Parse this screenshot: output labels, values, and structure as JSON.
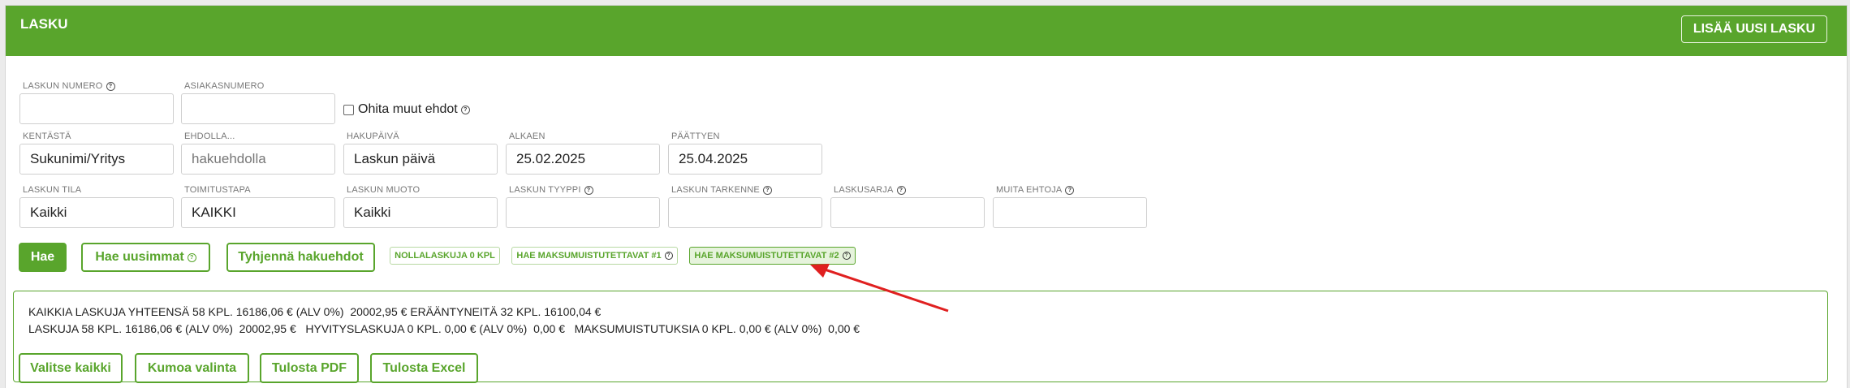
{
  "header": {
    "title": "LASKU",
    "add_button": "LISÄÄ UUSI LASKU"
  },
  "filters": {
    "laskun_numero": {
      "label": "LASKUN NUMERO",
      "value": ""
    },
    "asiakasnumero": {
      "label": "ASIAKASNUMERO",
      "value": ""
    },
    "ohita": {
      "label": "Ohita muut ehdot",
      "checked": false
    },
    "kentasta": {
      "label": "KENTÄSTÄ",
      "value": "Sukunimi/Yritys"
    },
    "ehdolla": {
      "label": "EHDOLLA...",
      "placeholder": "hakuehdolla"
    },
    "hakupaiva": {
      "label": "HAKUPÄIVÄ",
      "value": "Laskun päivä"
    },
    "alkaen": {
      "label": "ALKAEN",
      "value": "25.02.2025"
    },
    "paattyen": {
      "label": "PÄÄTTYEN",
      "value": "25.04.2025"
    },
    "laskun_tila": {
      "label": "LASKUN TILA",
      "value": "Kaikki"
    },
    "toimitustapa": {
      "label": "TOIMITUSTAPA",
      "value": "KAIKKI"
    },
    "laskun_muoto": {
      "label": "LASKUN MUOTO",
      "value": "Kaikki"
    },
    "laskun_tyyppi": {
      "label": "LASKUN TYYPPI",
      "value": ""
    },
    "laskun_tarkenne": {
      "label": "LASKUN TARKENNE",
      "value": ""
    },
    "laskusarja": {
      "label": "LASKUSARJA",
      "value": ""
    },
    "muita_ehtoja": {
      "label": "MUITA EHTOJA",
      "value": ""
    }
  },
  "actions": {
    "hae": "Hae",
    "hae_uusimmat": "Hae uusimmat",
    "tyhjenna": "Tyhjennä hakuehdot",
    "nollalaskuja": "NOLLALASKUJA 0 KPL",
    "hae_maksu1": "HAE MAKSUMUISTUTETTAVAT #1",
    "hae_maksu2": "HAE MAKSUMUISTUTETTAVAT #2"
  },
  "summary": {
    "line1": "KAIKKIA LASKUJA YHTEENSÄ 58 KPL. 16186,06 € (ALV 0%)  20002,95 € ERÄÄNTYNEITÄ 32 KPL. 16100,04 €",
    "line2": "LASKUJA 58 KPL. 16186,06 € (ALV 0%)  20002,95 €   HYVITYSLASKUJA 0 KPL. 0,00 € (ALV 0%)  0,00 €   MAKSUMUISTUTUKSIA 0 KPL. 0,00 € (ALV 0%)  0,00 €"
  },
  "bottom": {
    "valitse": "Valitse kaikki",
    "kumoa": "Kumoa valinta",
    "pdf": "Tulosta PDF",
    "excel": "Tulosta Excel"
  },
  "help_glyph": "?",
  "colors": {
    "brand_green": "#59a52c",
    "annotation_red": "#e02020"
  }
}
